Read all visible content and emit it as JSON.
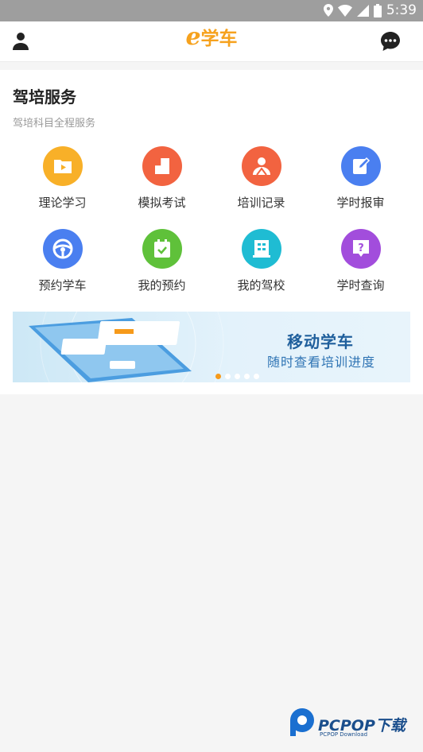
{
  "status_bar": {
    "time": "5:39"
  },
  "app_bar": {
    "brand_e": "e",
    "brand_text": "学车"
  },
  "section": {
    "title": "驾培服务",
    "subtitle": "驾培科目全程服务",
    "items": [
      {
        "label": "理论学习",
        "icon": "video-folder-icon",
        "color": "#f8b028"
      },
      {
        "label": "模拟考试",
        "icon": "document-icon",
        "color": "#f26340"
      },
      {
        "label": "培训记录",
        "icon": "instructor-icon",
        "color": "#f26340"
      },
      {
        "label": "学时报审",
        "icon": "edit-icon",
        "color": "#4a7ff0"
      },
      {
        "label": "预约学车",
        "icon": "steering-wheel-icon",
        "color": "#4a7ff0"
      },
      {
        "label": "我的预约",
        "icon": "calendar-check-icon",
        "color": "#5fc13a"
      },
      {
        "label": "我的驾校",
        "icon": "building-icon",
        "color": "#1fbcd3"
      },
      {
        "label": "学时查询",
        "icon": "question-icon",
        "color": "#a24ddc"
      }
    ]
  },
  "banner": {
    "headline": "移动学车",
    "tagline": "随时查看培训进度",
    "active_slide": 1,
    "slide_count": 5
  },
  "watermark": {
    "brand": "PCPOP下载",
    "sub": "PCPOP Download"
  }
}
